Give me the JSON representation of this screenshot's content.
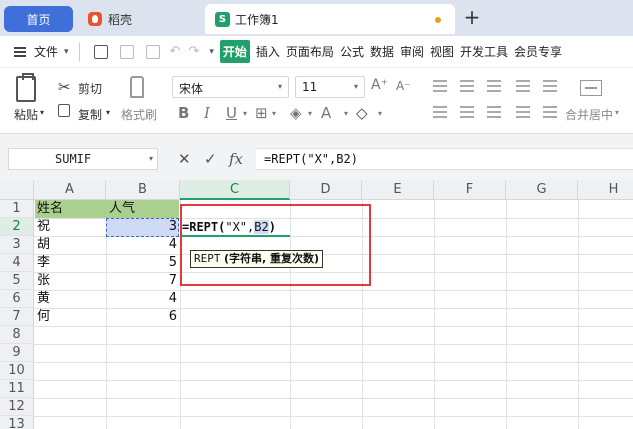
{
  "tabs": {
    "home": "首页",
    "daoke": "稻壳",
    "workbook": "工作簿1",
    "workbook_icon": "S",
    "add": "+"
  },
  "menu": {
    "file": "文件",
    "items": [
      "开始",
      "插入",
      "页面布局",
      "公式",
      "数据",
      "审阅",
      "视图",
      "开发工具",
      "会员专享"
    ]
  },
  "ribbon": {
    "paste": "粘贴",
    "cut": "剪切",
    "copy": "复制",
    "format_painter": "格式刷",
    "font": "宋体",
    "size": "11",
    "merge": "合并居中"
  },
  "formula_bar": {
    "name_box": "SUMIF",
    "cancel": "✕",
    "confirm": "✓",
    "fx": "fx",
    "formula": "=REPT(\"X\",B2)"
  },
  "grid": {
    "columns": [
      "A",
      "B",
      "C",
      "D",
      "E",
      "F",
      "G",
      "H"
    ],
    "rows": [
      "1",
      "2",
      "3",
      "4",
      "5",
      "6",
      "7",
      "8",
      "9",
      "10",
      "11",
      "12",
      "13"
    ],
    "header": [
      "姓名",
      "人气"
    ],
    "data": [
      {
        "name": "祝",
        "value": "3"
      },
      {
        "name": "胡",
        "value": "4"
      },
      {
        "name": "李",
        "value": "5"
      },
      {
        "name": "张",
        "value": "7"
      },
      {
        "name": "黄",
        "value": "4"
      },
      {
        "name": "何",
        "value": "6"
      }
    ],
    "edit_formula_fn": "=REPT",
    "edit_formula_open": "(",
    "edit_formula_arg1": "\"X\",",
    "edit_formula_ref": "B2",
    "edit_formula_close": ")",
    "tooltip_fn": "REPT",
    "tooltip_args": "(字符串, 重复次数)"
  },
  "colors": {
    "accent": "#22a06b",
    "home_tab": "#3f6fd8",
    "header_fill": "#a9d08e",
    "highlight_box": "#e2383f"
  }
}
